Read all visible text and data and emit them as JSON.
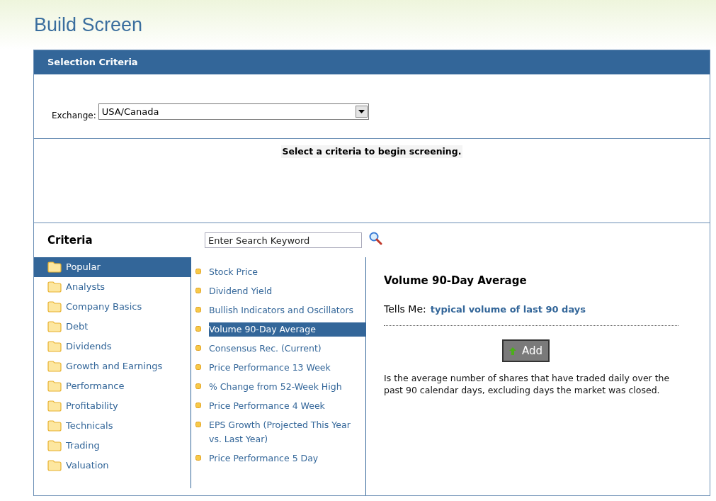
{
  "title": "Build Screen",
  "panel": {
    "header": "Selection Criteria"
  },
  "exchange": {
    "label": "Exchange:",
    "value": "USA/Canada"
  },
  "message": "Select a criteria to begin screening.",
  "criteria": {
    "heading": "Criteria",
    "search": {
      "placeholder": "Enter Search Keyword"
    },
    "categories": [
      {
        "label": "Popular",
        "selected": true
      },
      {
        "label": "Analysts",
        "selected": false
      },
      {
        "label": "Company Basics",
        "selected": false
      },
      {
        "label": "Debt",
        "selected": false
      },
      {
        "label": "Dividends",
        "selected": false
      },
      {
        "label": "Growth and Earnings",
        "selected": false
      },
      {
        "label": "Performance",
        "selected": false
      },
      {
        "label": "Profitability",
        "selected": false
      },
      {
        "label": "Technicals",
        "selected": false
      },
      {
        "label": "Trading",
        "selected": false
      },
      {
        "label": "Valuation",
        "selected": false
      }
    ],
    "items": [
      {
        "label": "Stock Price",
        "selected": false
      },
      {
        "label": "Dividend Yield",
        "selected": false
      },
      {
        "label": "Bullish Indicators and Oscillators",
        "selected": false
      },
      {
        "label": "Volume 90-Day Average",
        "selected": true
      },
      {
        "label": "Consensus Rec. (Current)",
        "selected": false
      },
      {
        "label": "Price Performance 13 Week",
        "selected": false
      },
      {
        "label": "% Change from 52-Week High",
        "selected": false
      },
      {
        "label": "Price Performance 4 Week",
        "selected": false
      },
      {
        "label": "EPS Growth (Projected This Year vs. Last Year)",
        "selected": false
      },
      {
        "label": "Price Performance 5 Day",
        "selected": false
      }
    ],
    "detail": {
      "title": "Volume 90-Day Average",
      "tells_me_label": "Tells Me:",
      "tells_me": "typical volume of last 90 days",
      "add_button": "Add",
      "description": "Is the average number of shares that have traded daily over the past 90 calendar days, excluding days the market was closed."
    }
  }
}
